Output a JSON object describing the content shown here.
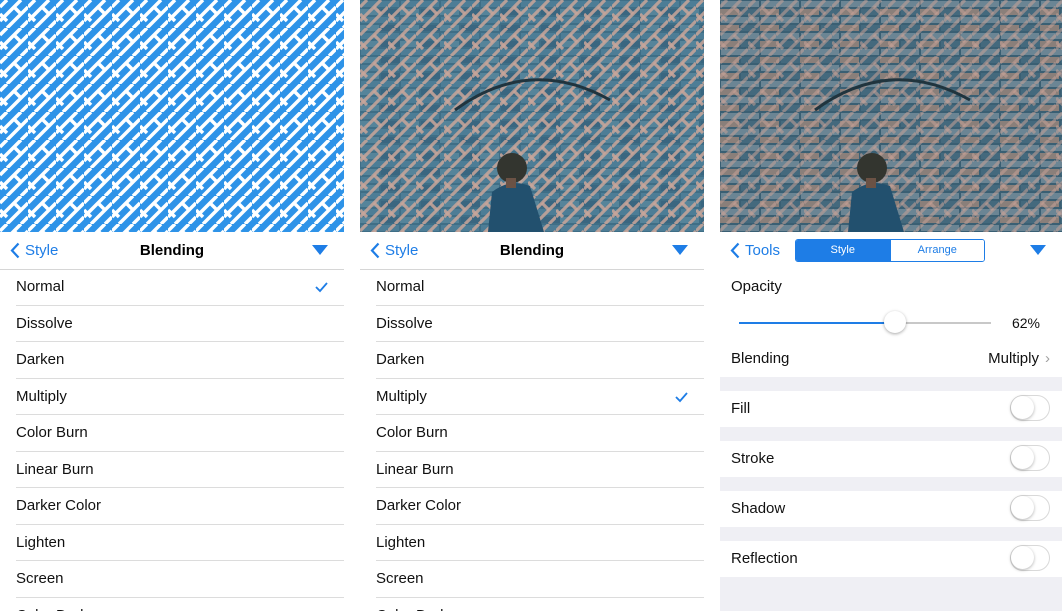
{
  "colors": {
    "accent": "#1e7de6",
    "pattern_blue": "#2e93e8"
  },
  "left": {
    "nav": {
      "back": "Style",
      "title": "Blending"
    },
    "selected": "Normal",
    "modes": [
      "Normal",
      "Dissolve",
      "Darken",
      "Multiply",
      "Color Burn",
      "Linear Burn",
      "Darker Color",
      "Lighten",
      "Screen",
      "Color Dodge"
    ]
  },
  "middle": {
    "nav": {
      "back": "Style",
      "title": "Blending"
    },
    "selected": "Multiply",
    "modes": [
      "Normal",
      "Dissolve",
      "Darken",
      "Multiply",
      "Color Burn",
      "Linear Burn",
      "Darker Color",
      "Lighten",
      "Screen",
      "Color Dodge"
    ]
  },
  "right": {
    "nav": {
      "back": "Tools",
      "seg_style": "Style",
      "seg_arrange": "Arrange"
    },
    "opacity": {
      "label": "Opacity",
      "value_text": "62%",
      "value": 0.62
    },
    "blending": {
      "label": "Blending",
      "value": "Multiply"
    },
    "fill": {
      "label": "Fill",
      "on": false
    },
    "stroke": {
      "label": "Stroke",
      "on": false
    },
    "shadow": {
      "label": "Shadow",
      "on": false
    },
    "reflection": {
      "label": "Reflection",
      "on": false
    }
  }
}
